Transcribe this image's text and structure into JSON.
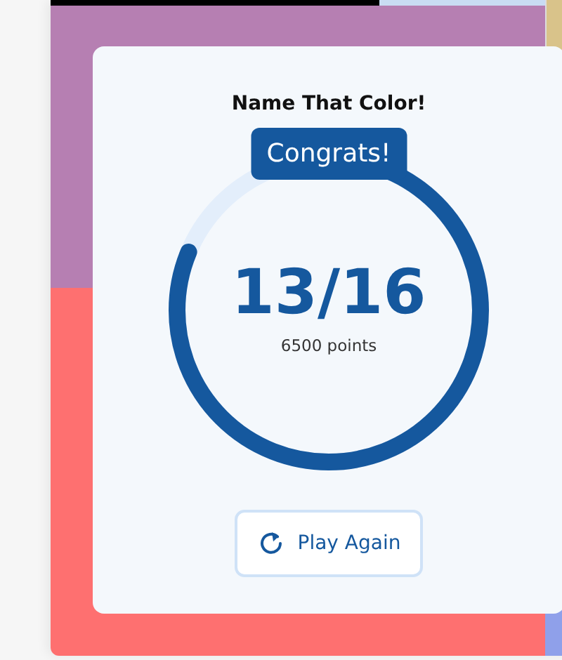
{
  "board": {
    "tiles": [
      {
        "color": "#000000"
      },
      {
        "color": "#c9dcf3"
      },
      {
        "color": "#b67fb2"
      },
      {
        "color": "#d9c38a"
      },
      {
        "color": "#fe7070"
      },
      {
        "color": "#8fa0ea"
      }
    ]
  },
  "result": {
    "title": "Name That Color!",
    "badge": "Congrats!",
    "score": "13/16",
    "points": "6500 points",
    "level": 0.8125,
    "button": "Play Again"
  }
}
